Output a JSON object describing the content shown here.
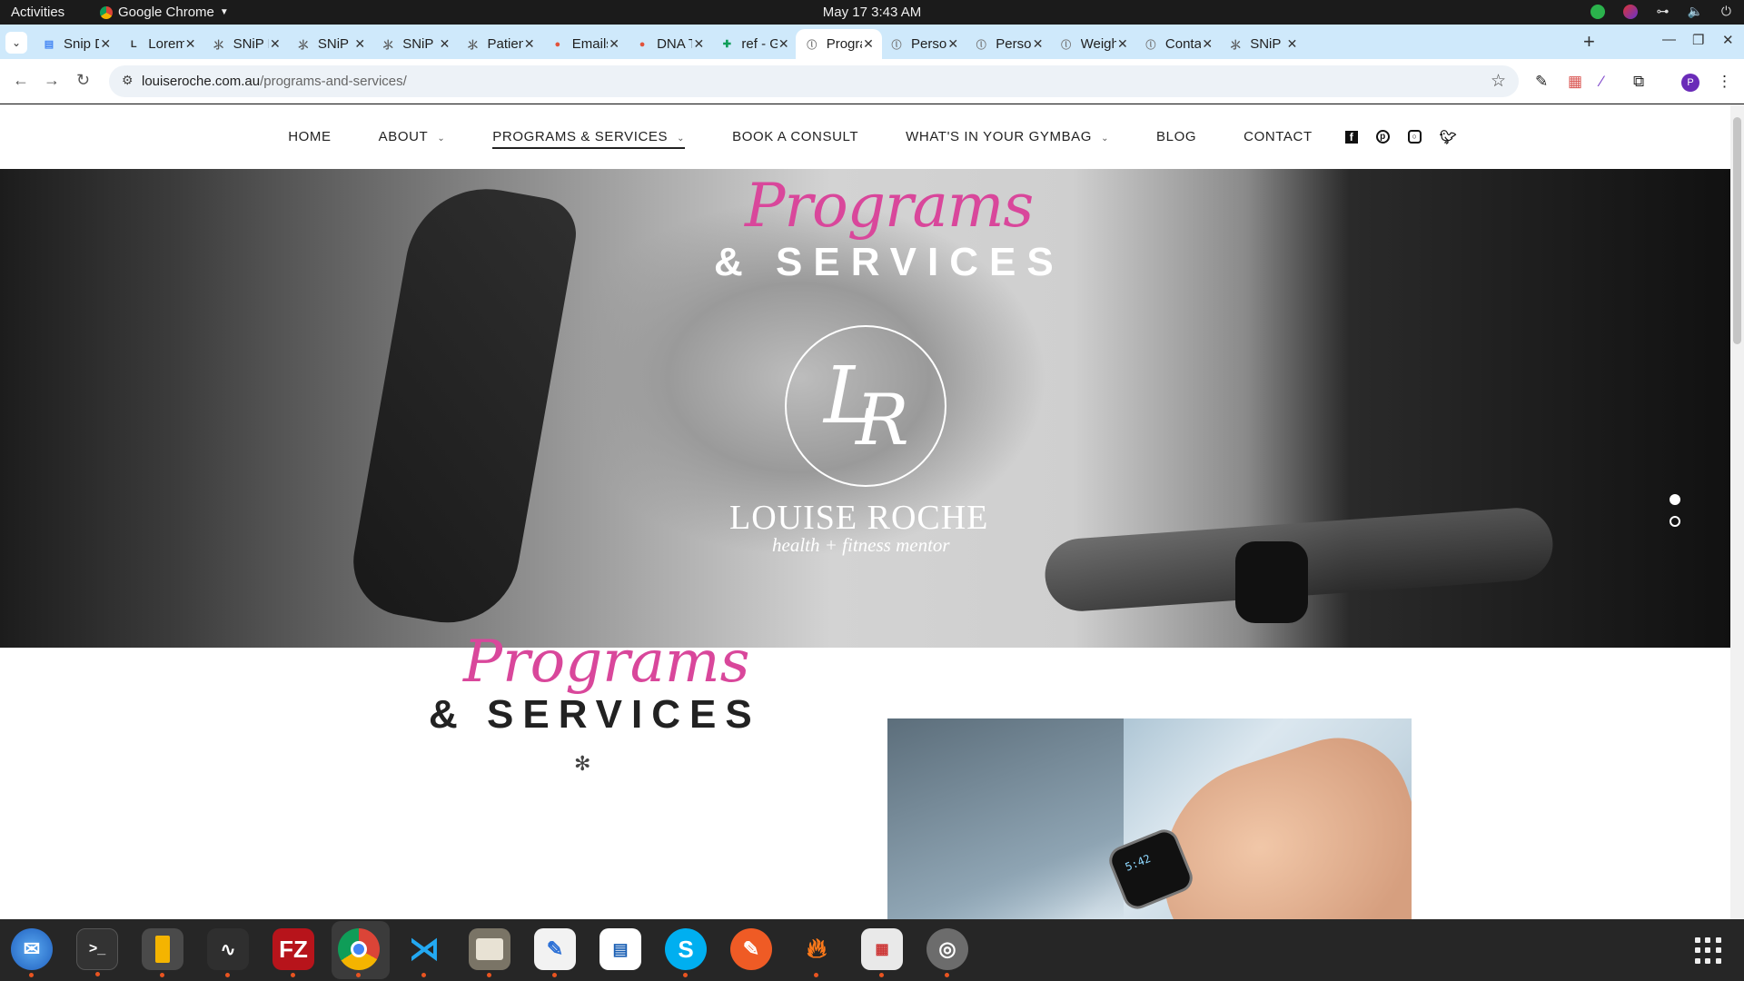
{
  "desktop": {
    "activities": "Activities",
    "app_name": "Google Chrome",
    "clock": "May 17  3:43 AM"
  },
  "tabs": [
    {
      "title": "Snip D",
      "favicon": "doc-icon",
      "color": "#4285f4"
    },
    {
      "title": "Lorem",
      "favicon": "L",
      "color": "#333333"
    },
    {
      "title": "SNiP N",
      "favicon": "snip-icon",
      "color": "#555555"
    },
    {
      "title": "SNiP N",
      "favicon": "snip-icon",
      "color": "#555555"
    },
    {
      "title": "SNiP N",
      "favicon": "snip-icon",
      "color": "#555555"
    },
    {
      "title": "Patien",
      "favicon": "snip-icon",
      "color": "#555555"
    },
    {
      "title": "Emails",
      "favicon": "ff-icon",
      "color": "#e2533b"
    },
    {
      "title": "DNA T",
      "favicon": "ff-icon",
      "color": "#e2533b"
    },
    {
      "title": "ref - G",
      "favicon": "sheets-icon",
      "color": "#0f9d58"
    },
    {
      "title": "Progra",
      "favicon": "lr-icon",
      "color": "#777777"
    },
    {
      "title": "Persor",
      "favicon": "lr-icon",
      "color": "#777777"
    },
    {
      "title": "Persor",
      "favicon": "lr-icon",
      "color": "#777777"
    },
    {
      "title": "Weigh",
      "favicon": "lr-icon",
      "color": "#777777"
    },
    {
      "title": "Conta",
      "favicon": "lr-icon",
      "color": "#777777"
    },
    {
      "title": "SNiP N",
      "favicon": "snip-icon",
      "color": "#555555"
    }
  ],
  "active_tab_index": 9,
  "omnibox": {
    "domain": "louiseroche.com.au",
    "path": "/programs-and-services/"
  },
  "profile_initial": "P",
  "site_nav": {
    "items": [
      {
        "label": "HOME",
        "caret": false
      },
      {
        "label": "ABOUT",
        "caret": true
      },
      {
        "label": "PROGRAMS & SERVICES",
        "caret": true,
        "current": true
      },
      {
        "label": "BOOK A CONSULT",
        "caret": false
      },
      {
        "label": "WHAT'S IN YOUR GYMBAG",
        "caret": true
      },
      {
        "label": "BLOG",
        "caret": false
      },
      {
        "label": "CONTACT",
        "caret": false
      }
    ],
    "social": [
      "f",
      "P",
      "◎",
      "🐦"
    ]
  },
  "hero": {
    "script_title": "Programs",
    "caps_title": "& SERVICES",
    "logo_l": "L",
    "logo_r": "R",
    "brand_name": "LOUISE ROCHE",
    "brand_tagline": "health + fitness mentor",
    "slide_count": 2,
    "active_slide": 1
  },
  "section": {
    "script_title": "Programs",
    "caps_title": "& SERVICES",
    "divider": "✻",
    "watch_time": "5:42"
  },
  "dock": {
    "apps": [
      "thunderbird",
      "terminal",
      "calculator",
      "system-monitor",
      "filezilla",
      "chrome",
      "vscode",
      "files",
      "text-editor",
      "libreoffice-writer",
      "skype",
      "postman",
      "blender-like",
      "document-viewer",
      "disks"
    ]
  },
  "colors": {
    "accent_pink": "#d9479b",
    "tab_strip": "#cfe9fb",
    "dock_running": "#e95420"
  }
}
